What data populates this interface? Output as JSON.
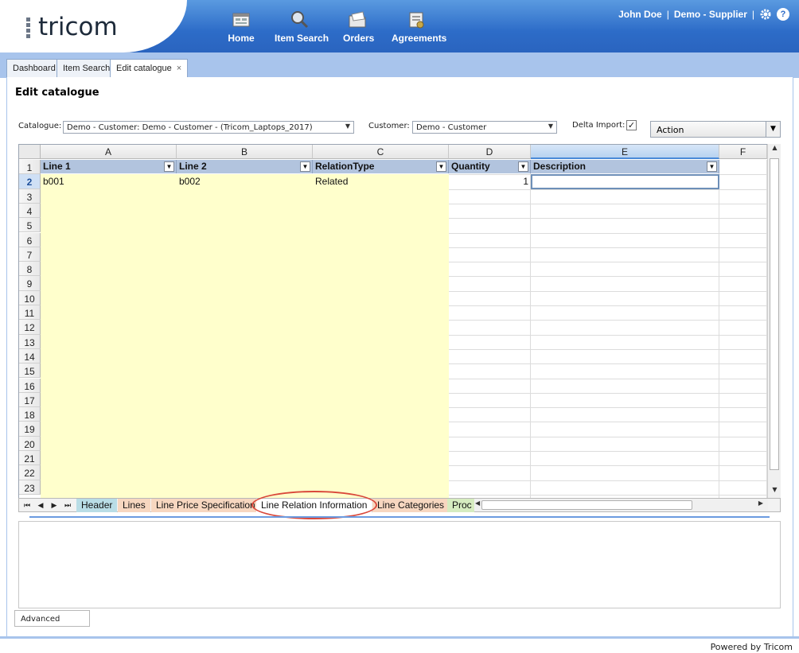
{
  "app": {
    "logo_text": "tricom",
    "powered_by": "Powered by Tricom",
    "colors": {
      "header_blue": "#2d6cc8",
      "tab_strip": "#a8c4ec",
      "yellow_fill": "#ffffcc",
      "column_header": "#b2c4de",
      "highlight_oval": "#d9483b"
    }
  },
  "nav": [
    {
      "label": "Home",
      "icon": "home-icon"
    },
    {
      "label": "Item Search",
      "icon": "magnifier-icon"
    },
    {
      "label": "Orders",
      "icon": "folder-icon"
    },
    {
      "label": "Agreements",
      "icon": "agreements-icon"
    }
  ],
  "user": {
    "name": "John Doe",
    "separator": "|",
    "company": "Demo - Supplier",
    "separator2": "|"
  },
  "tabs": [
    {
      "label": "Dashboard"
    },
    {
      "label": "Item Search"
    },
    {
      "label": "Edit catalogue",
      "close": "×"
    }
  ],
  "page": {
    "title": "Edit catalogue",
    "catalogue_label": "Catalogue:",
    "catalogue_value": "Demo - Customer: Demo - Customer - (Tricom_Laptops_2017)",
    "customer_label": "Customer:",
    "customer_value": "Demo - Customer",
    "delta_label": "Delta Import:",
    "delta_checked": "✓",
    "action_value": "Action",
    "advanced_label": "Advanced"
  },
  "sheet": {
    "columns": [
      "A",
      "B",
      "C",
      "D",
      "E",
      "F"
    ],
    "header_row": [
      "Line 1",
      "Line 2",
      "RelationType",
      "Quantity",
      "Description"
    ],
    "row_numbers": [
      "1",
      "2",
      "3",
      "4",
      "5",
      "6",
      "7",
      "8",
      "9",
      "10",
      "11",
      "12",
      "13",
      "14",
      "15",
      "16",
      "17",
      "18",
      "19",
      "20",
      "21",
      "22",
      "23"
    ],
    "data_row": {
      "line1": "b001",
      "line2": "b002",
      "relation_type": "Related",
      "quantity": "1",
      "description": ""
    },
    "sheet_tabs": [
      "Header",
      "Lines",
      "Line Price Specification",
      "Line Relation Information",
      "Line Categories",
      "Proc"
    ]
  }
}
